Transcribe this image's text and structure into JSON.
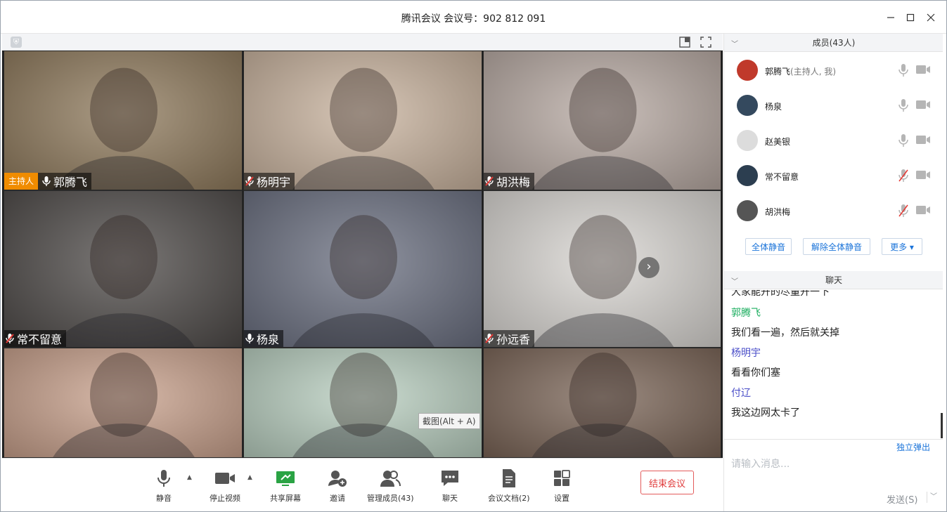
{
  "window": {
    "title": "腾讯会议 会议号：902 812 091",
    "minimize": "—",
    "maximize": "☐",
    "close": "✕"
  },
  "video": {
    "tiles": [
      {
        "name": "郭腾飞",
        "host_badge": "主持人",
        "muted": false,
        "bg": "#8f7a5c"
      },
      {
        "name": "杨明宇",
        "muted": true,
        "bg": "#c9b39e"
      },
      {
        "name": "胡洪梅",
        "muted": true,
        "bg": "#b8aaa3"
      },
      {
        "name": "常不留意",
        "muted": true,
        "bg": "#4e4a48"
      },
      {
        "name": "杨泉",
        "muted": false,
        "bg": "#6a6f80"
      },
      {
        "name": "孙远香",
        "muted": true,
        "bg": "#d9d6d2"
      },
      {
        "name": "",
        "muted": false,
        "bg": "#c9a18c"
      },
      {
        "name": "",
        "muted": false,
        "bg": "#b9cfc0"
      },
      {
        "name": "",
        "muted": false,
        "bg": "#7a6456"
      }
    ],
    "tooltip": "截图(Alt + A)"
  },
  "toolbar": {
    "mute": "静音",
    "stop_video": "停止视频",
    "share_screen": "共享屏幕",
    "invite": "邀请",
    "manage_members": "管理成员(43)",
    "chat": "聊天",
    "meeting_docs": "会议文档(2)",
    "settings": "设置",
    "end_meeting": "结束会议"
  },
  "members": {
    "header": "成员(43人)",
    "list": [
      {
        "name": "郭腾飞",
        "role": "(主持人, 我)",
        "mic_muted": false,
        "avatar_color": "#c0392b"
      },
      {
        "name": "杨泉",
        "role": "",
        "mic_muted": false,
        "avatar_color": "#34495e"
      },
      {
        "name": "赵美银",
        "role": "",
        "mic_muted": false,
        "avatar_color": "#dcdcdc"
      },
      {
        "name": "常不留意",
        "role": "",
        "mic_muted": true,
        "avatar_color": "#2c3e50"
      },
      {
        "name": "胡洪梅",
        "role": "",
        "mic_muted": true,
        "avatar_color": "#555555"
      }
    ],
    "mute_all": "全体静音",
    "unmute_all": "解除全体静音",
    "more": "更多 ▾"
  },
  "chat": {
    "header": "聊天",
    "clipped_line": "大家能开的尽量开一下",
    "messages": [
      {
        "sender": "郭腾飞",
        "text": "我们看一遍，然后就关掉",
        "color": "#1aad5e"
      },
      {
        "sender": "杨明宇",
        "text": "看看你们塞",
        "color": "#4a4ec8"
      },
      {
        "sender": "付辽",
        "text": "我这边网太卡了",
        "color": "#4a4ec8"
      }
    ],
    "popout": "独立弹出",
    "placeholder": "请输入消息...",
    "send": "发送(S)"
  }
}
